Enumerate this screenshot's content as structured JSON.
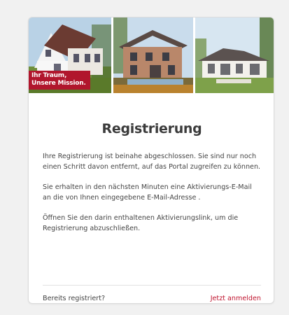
{
  "banner": {
    "slogan_line1": "Ihr Traum,",
    "slogan_line2": "Unsere Mission.",
    "slogan_color": "#b1162d"
  },
  "card": {
    "title": "Registrierung",
    "paragraph1": "Ihre Registrierung ist beinahe abgeschlossen. Sie sind nur noch einen Schritt davon entfernt, auf das Portal zugreifen zu können.",
    "paragraph2": "Sie erhalten in den nächsten Minuten eine Aktivierungs-E-Mail an die von Ihnen eingegebene E-Mail-Adresse .",
    "paragraph3": "Öffnen Sie den darin enthaltenen Aktivierungslink, um die Registrierung abzuschließen."
  },
  "footer": {
    "question": "Bereits registriert?",
    "login_link": "Jetzt anmelden",
    "link_color": "#c0152f"
  }
}
